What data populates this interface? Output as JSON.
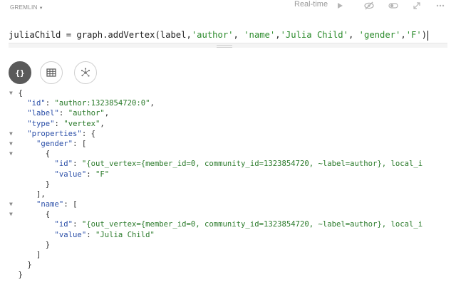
{
  "toolbar": {
    "language": "GREMLIN",
    "mode": "Real-time",
    "icons": [
      "play-icon",
      "eye-slash-icon",
      "toggle-icon",
      "expand-icon",
      "more-icon"
    ]
  },
  "editor": {
    "query_code": "juliaChild = graph.addVertex(label,",
    "query_args": [
      {
        "t": "'author'",
        "s": true
      },
      {
        "t": ", ",
        "s": false
      },
      {
        "t": "'name'",
        "s": true
      },
      {
        "t": ",",
        "s": false
      },
      {
        "t": "'Julia Child'",
        "s": true
      },
      {
        "t": ", ",
        "s": false
      },
      {
        "t": "'gender'",
        "s": true
      },
      {
        "t": ",",
        "s": false
      },
      {
        "t": "'F'",
        "s": true
      },
      {
        "t": ")",
        "s": false
      }
    ]
  },
  "views": [
    {
      "name": "json-view-button",
      "icon": "braces-icon",
      "active": true
    },
    {
      "name": "table-view-button",
      "icon": "table-icon",
      "active": false
    },
    {
      "name": "graph-view-button",
      "icon": "graph-icon",
      "active": false
    }
  ],
  "result": {
    "lines": [
      {
        "indent": 4,
        "arrow": true,
        "parts": [
          {
            "t": "{",
            "c": "p"
          }
        ]
      },
      {
        "indent": 6,
        "arrow": false,
        "parts": [
          {
            "t": "\"id\"",
            "c": "k"
          },
          {
            "t": ": ",
            "c": "p"
          },
          {
            "t": "\"author:1323854720:0\"",
            "c": "v"
          },
          {
            "t": ",",
            "c": "p"
          }
        ]
      },
      {
        "indent": 6,
        "arrow": false,
        "parts": [
          {
            "t": "\"label\"",
            "c": "k"
          },
          {
            "t": ": ",
            "c": "p"
          },
          {
            "t": "\"author\"",
            "c": "v"
          },
          {
            "t": ",",
            "c": "p"
          }
        ]
      },
      {
        "indent": 6,
        "arrow": false,
        "parts": [
          {
            "t": "\"type\"",
            "c": "k"
          },
          {
            "t": ": ",
            "c": "p"
          },
          {
            "t": "\"vertex\"",
            "c": "v"
          },
          {
            "t": ",",
            "c": "p"
          }
        ]
      },
      {
        "indent": 6,
        "arrow": true,
        "parts": [
          {
            "t": "\"properties\"",
            "c": "k"
          },
          {
            "t": ": {",
            "c": "p"
          }
        ]
      },
      {
        "indent": 8,
        "arrow": true,
        "parts": [
          {
            "t": "\"gender\"",
            "c": "k"
          },
          {
            "t": ": [",
            "c": "p"
          }
        ]
      },
      {
        "indent": 10,
        "arrow": true,
        "parts": [
          {
            "t": "{",
            "c": "p"
          }
        ]
      },
      {
        "indent": 12,
        "arrow": false,
        "parts": [
          {
            "t": "\"id\"",
            "c": "k"
          },
          {
            "t": ": ",
            "c": "p"
          },
          {
            "t": "\"{out_vertex={member_id=0, community_id=1323854720, ~label=author}, local_i",
            "c": "v"
          }
        ]
      },
      {
        "indent": 12,
        "arrow": false,
        "parts": [
          {
            "t": "\"value\"",
            "c": "k"
          },
          {
            "t": ": ",
            "c": "p"
          },
          {
            "t": "\"F\"",
            "c": "v"
          }
        ]
      },
      {
        "indent": 10,
        "arrow": false,
        "parts": [
          {
            "t": "}",
            "c": "p"
          }
        ]
      },
      {
        "indent": 8,
        "arrow": false,
        "parts": [
          {
            "t": "],",
            "c": "p"
          }
        ]
      },
      {
        "indent": 8,
        "arrow": true,
        "parts": [
          {
            "t": "\"name\"",
            "c": "k"
          },
          {
            "t": ": [",
            "c": "p"
          }
        ]
      },
      {
        "indent": 10,
        "arrow": true,
        "parts": [
          {
            "t": "{",
            "c": "p"
          }
        ]
      },
      {
        "indent": 12,
        "arrow": false,
        "parts": [
          {
            "t": "\"id\"",
            "c": "k"
          },
          {
            "t": ": ",
            "c": "p"
          },
          {
            "t": "\"{out_vertex={member_id=0, community_id=1323854720, ~label=author}, local_i",
            "c": "v"
          }
        ]
      },
      {
        "indent": 12,
        "arrow": false,
        "parts": [
          {
            "t": "\"value\"",
            "c": "k"
          },
          {
            "t": ": ",
            "c": "p"
          },
          {
            "t": "\"Julia Child\"",
            "c": "v"
          }
        ]
      },
      {
        "indent": 10,
        "arrow": false,
        "parts": [
          {
            "t": "}",
            "c": "p"
          }
        ]
      },
      {
        "indent": 8,
        "arrow": false,
        "parts": [
          {
            "t": "]",
            "c": "p"
          }
        ]
      },
      {
        "indent": 6,
        "arrow": false,
        "parts": [
          {
            "t": "}",
            "c": "p"
          }
        ]
      },
      {
        "indent": 4,
        "arrow": false,
        "parts": [
          {
            "t": "}",
            "c": "p"
          }
        ]
      }
    ]
  }
}
